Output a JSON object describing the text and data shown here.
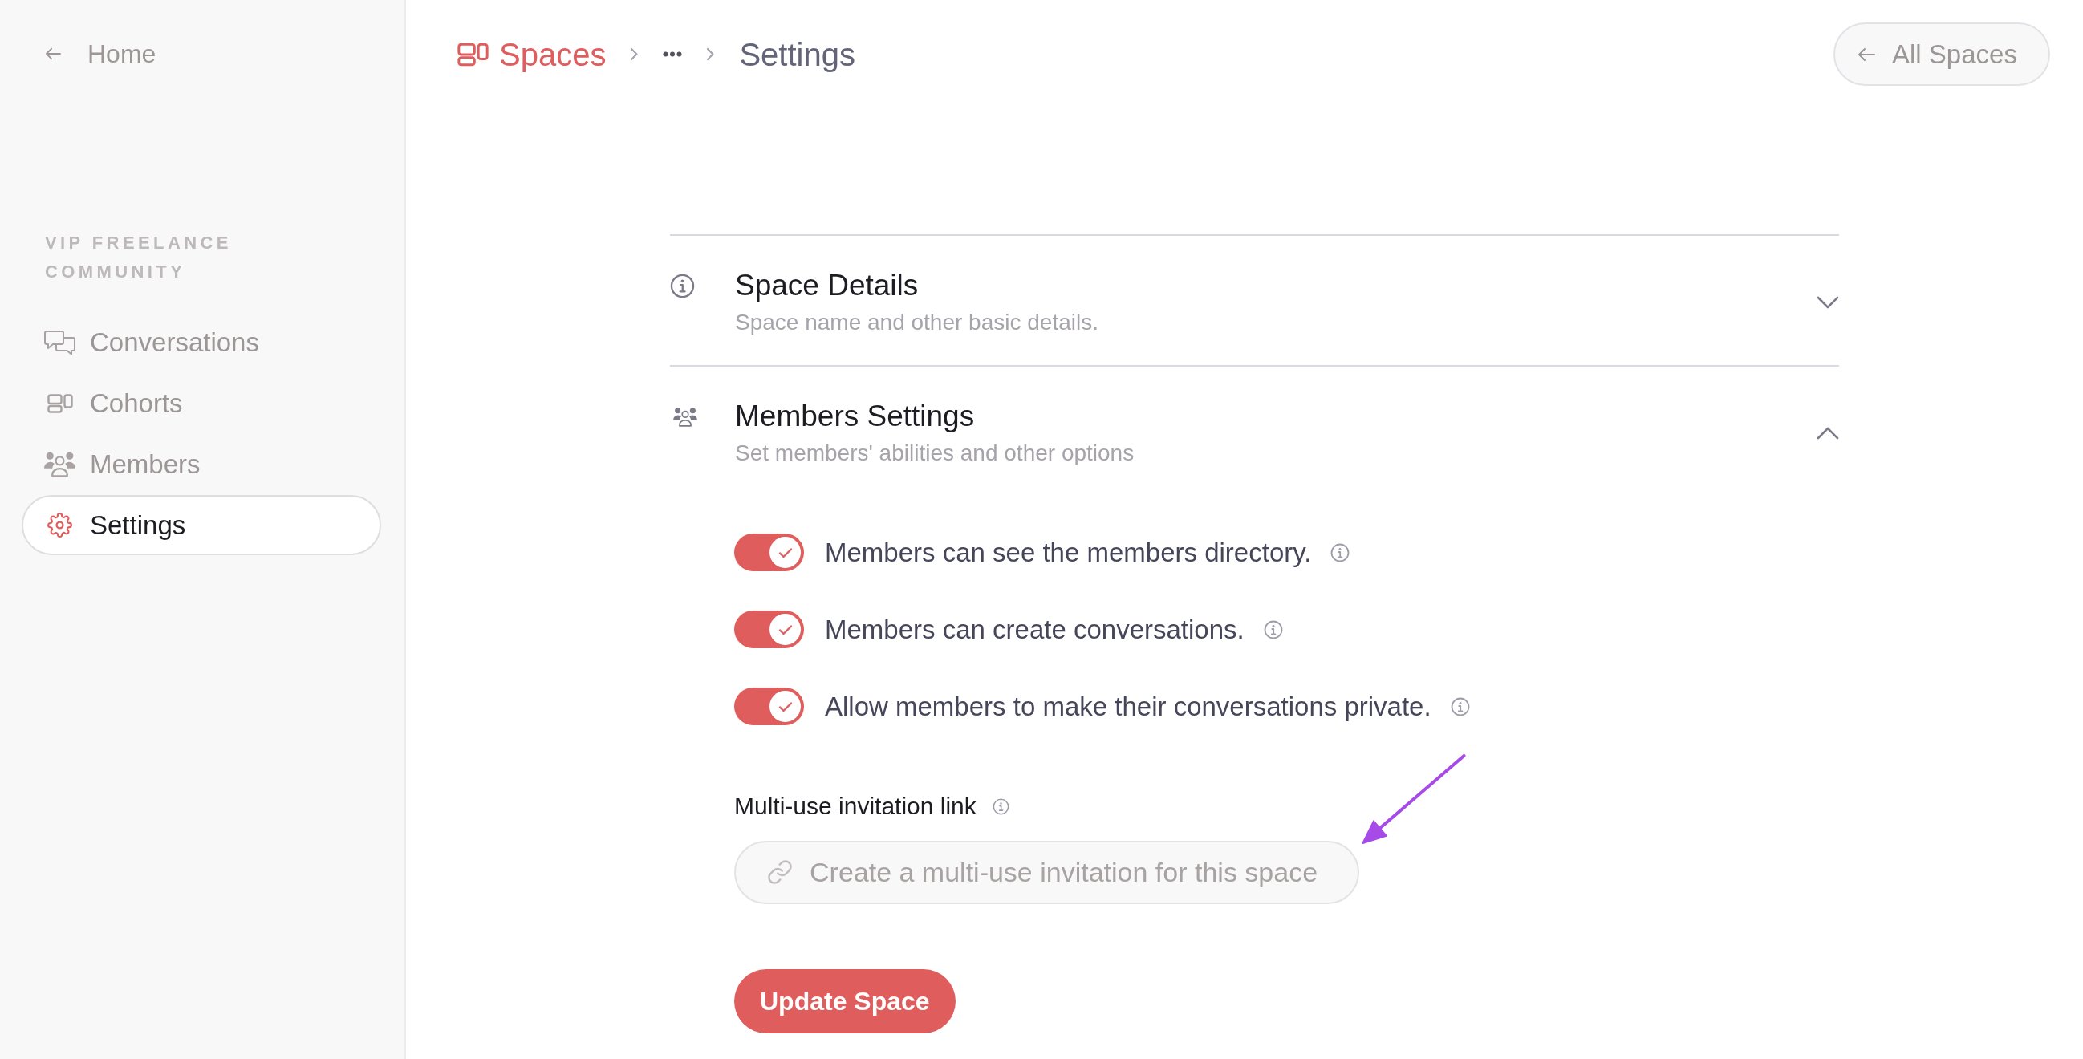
{
  "sidebar": {
    "home_link": {
      "label": "Home"
    },
    "section_title": "VIP FREELANCE COMMUNITY",
    "items": [
      {
        "label": "Conversations",
        "selected": false
      },
      {
        "label": "Cohorts",
        "selected": false
      },
      {
        "label": "Members",
        "selected": false
      },
      {
        "label": "Settings",
        "selected": true
      }
    ]
  },
  "breadcrumb": {
    "root": "Spaces",
    "current": "Settings"
  },
  "all_spaces_button": {
    "label": "All Spaces"
  },
  "sections": [
    {
      "kind": "details",
      "title": "Space Details",
      "subtitle": "Space name and other basic details.",
      "expanded": false
    },
    {
      "kind": "members",
      "title": "Members Settings",
      "subtitle": "Set members' abilities and other options",
      "expanded": true,
      "toggles": [
        {
          "label": "Members can see the members directory.",
          "on": true
        },
        {
          "label": "Members can create conversations.",
          "on": true
        },
        {
          "label": "Allow members to make their conversations private.",
          "on": true
        }
      ],
      "invitation_link": {
        "label": "Multi-use invitation link",
        "placeholder": "Create a multi-use invitation for this space"
      }
    }
  ],
  "submit_button": {
    "label": "Update Space"
  }
}
